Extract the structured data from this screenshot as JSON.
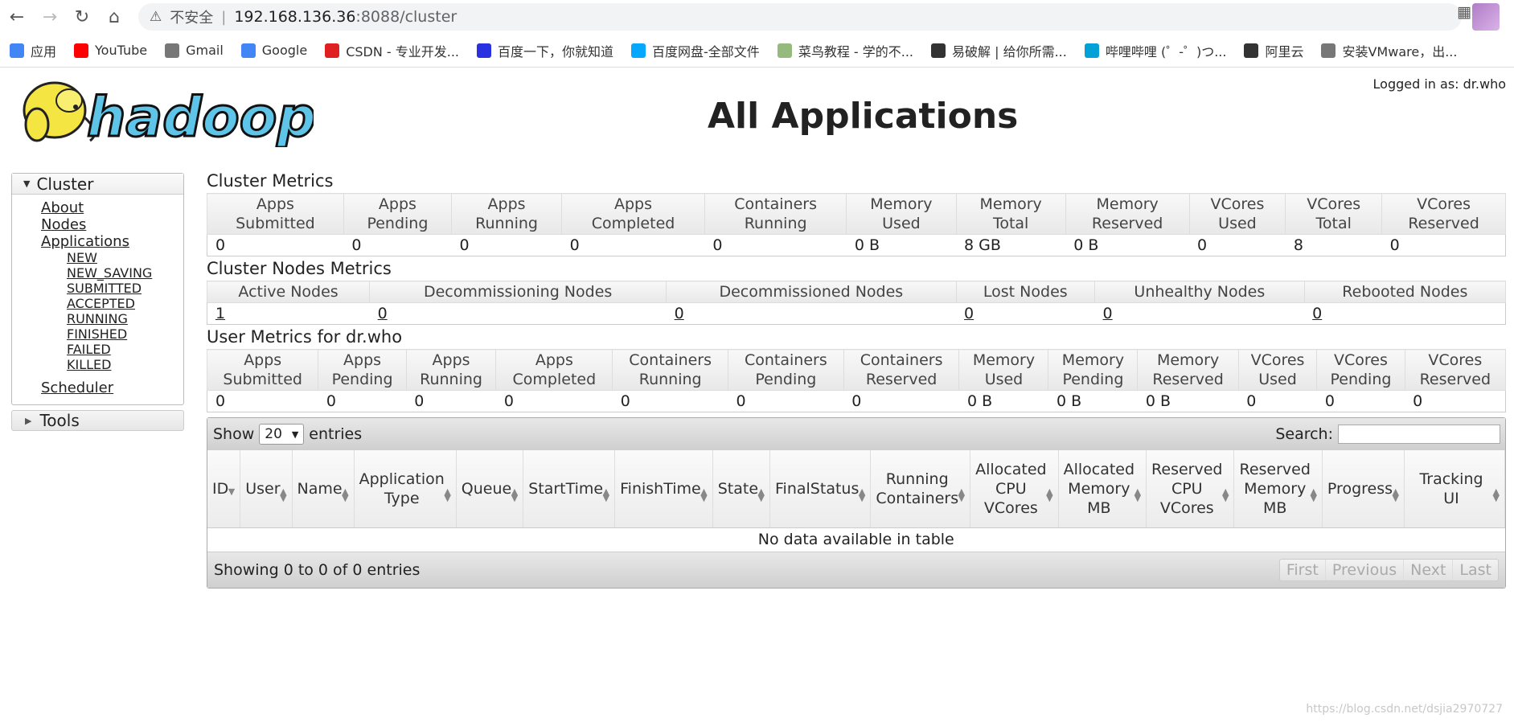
{
  "browser": {
    "insecure_label": "不安全",
    "url_host": "192.168.136.36",
    "url_rest": ":8088/cluster",
    "bookmarks": [
      {
        "label": "应用",
        "icon": "apps-grid-icon",
        "color": "#4285f4"
      },
      {
        "label": "YouTube",
        "icon": "youtube-icon",
        "color": "#ff0000"
      },
      {
        "label": "Gmail",
        "icon": "globe-icon",
        "color": "#777777"
      },
      {
        "label": "Google",
        "icon": "google-icon",
        "color": "#4285f4"
      },
      {
        "label": "CSDN - 专业开发...",
        "icon": "csdn-icon",
        "color": "#e02020"
      },
      {
        "label": "百度一下，你就知道",
        "icon": "baidu-icon",
        "color": "#2932e1"
      },
      {
        "label": "百度网盘-全部文件",
        "icon": "baidu-netdisk-icon",
        "color": "#06a7ff"
      },
      {
        "label": "菜鸟教程 - 学的不...",
        "icon": "runoob-icon",
        "color": "#96b97d"
      },
      {
        "label": "易破解 | 给你所需...",
        "icon": "ypj-icon",
        "color": "#333333"
      },
      {
        "label": "哔哩哔哩 (゜-゜)つ...",
        "icon": "bilibili-icon",
        "color": "#00a1d6"
      },
      {
        "label": "阿里云",
        "icon": "aliyun-icon",
        "color": "#333333"
      },
      {
        "label": "安装VMware，出...",
        "icon": "globe-icon",
        "color": "#777777"
      }
    ]
  },
  "header": {
    "logged_in": "Logged in as: dr.who",
    "title": "All Applications",
    "logo_text": "hadoop"
  },
  "sidebar": {
    "cluster_label": "Cluster",
    "links": [
      "About",
      "Nodes",
      "Applications"
    ],
    "states": [
      "NEW",
      "NEW_SAVING",
      "SUBMITTED",
      "ACCEPTED",
      "RUNNING",
      "FINISHED",
      "FAILED",
      "KILLED"
    ],
    "scheduler": "Scheduler",
    "tools_label": "Tools"
  },
  "cluster_metrics": {
    "title": "Cluster Metrics",
    "headers": [
      [
        "Apps",
        "Submitted"
      ],
      [
        "Apps",
        "Pending"
      ],
      [
        "Apps",
        "Running"
      ],
      [
        "Apps",
        "Completed"
      ],
      [
        "Containers",
        "Running"
      ],
      [
        "Memory",
        "Used"
      ],
      [
        "Memory",
        "Total"
      ],
      [
        "Memory",
        "Reserved"
      ],
      [
        "VCores",
        "Used"
      ],
      [
        "VCores",
        "Total"
      ],
      [
        "VCores",
        "Reserved"
      ]
    ],
    "values": [
      "0",
      "0",
      "0",
      "0",
      "0",
      "0 B",
      "8 GB",
      "0 B",
      "0",
      "8",
      "0"
    ]
  },
  "node_metrics": {
    "title": "Cluster Nodes Metrics",
    "headers": [
      "Active Nodes",
      "Decommissioning Nodes",
      "Decommissioned Nodes",
      "Lost Nodes",
      "Unhealthy Nodes",
      "Rebooted Nodes"
    ],
    "values": [
      "1",
      "0",
      "0",
      "0",
      "0",
      "0"
    ]
  },
  "user_metrics": {
    "title": "User Metrics for dr.who",
    "headers": [
      [
        "Apps",
        "Submitted"
      ],
      [
        "Apps",
        "Pending"
      ],
      [
        "Apps",
        "Running"
      ],
      [
        "Apps",
        "Completed"
      ],
      [
        "Containers",
        "Running"
      ],
      [
        "Containers",
        "Pending"
      ],
      [
        "Containers",
        "Reserved"
      ],
      [
        "Memory",
        "Used"
      ],
      [
        "Memory",
        "Pending"
      ],
      [
        "Memory",
        "Reserved"
      ],
      [
        "VCores",
        "Used"
      ],
      [
        "VCores",
        "Pending"
      ],
      [
        "VCores",
        "Reserved"
      ]
    ],
    "values": [
      "0",
      "0",
      "0",
      "0",
      "0",
      "0",
      "0",
      "0 B",
      "0 B",
      "0 B",
      "0",
      "0",
      "0"
    ]
  },
  "apps_table": {
    "show_label": "Show",
    "entries_value": "20",
    "entries_label": "entries",
    "search_label": "Search:",
    "columns": [
      [
        "ID"
      ],
      [
        "User"
      ],
      [
        "Name"
      ],
      [
        "Application",
        "Type"
      ],
      [
        "Queue"
      ],
      [
        "StartTime"
      ],
      [
        "FinishTime"
      ],
      [
        "State"
      ],
      [
        "FinalStatus"
      ],
      [
        "Running",
        "Containers"
      ],
      [
        "Allocated",
        "CPU",
        "VCores"
      ],
      [
        "Allocated",
        "Memory",
        "MB"
      ],
      [
        "Reserved",
        "CPU",
        "VCores"
      ],
      [
        "Reserved",
        "Memory",
        "MB"
      ],
      [
        "Progress"
      ],
      [
        "Tracking UI"
      ]
    ],
    "empty_text": "No data available in table",
    "showing_text": "Showing 0 to 0 of 0 entries",
    "pager": [
      "First",
      "Previous",
      "Next",
      "Last"
    ]
  },
  "watermark": "https://blog.csdn.net/dsjia2970727"
}
